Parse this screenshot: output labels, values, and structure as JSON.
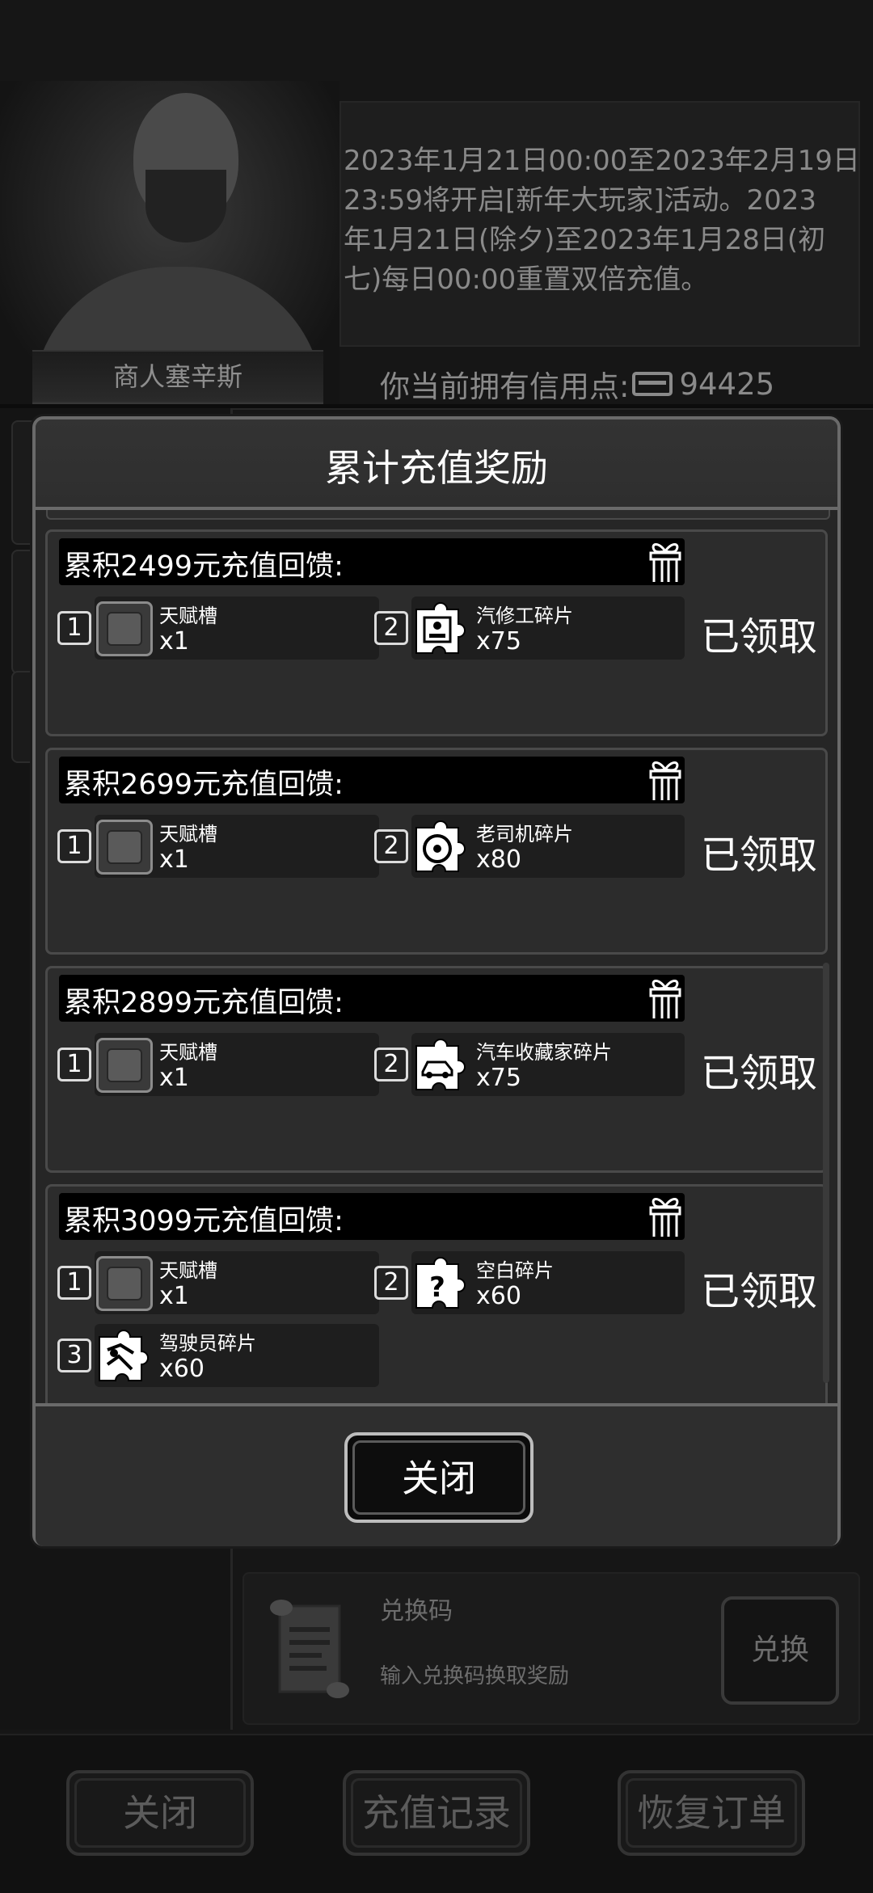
{
  "merchant": {
    "name": "商人塞辛斯",
    "notice_lines": [
      "2023年1月21日00:00至2023年2月19日",
      "23:59将开启[新年大玩家]活动。2023",
      "年1月21日(除夕)至2023年1月28日(初",
      "七)每日00:00重置双倍充值。"
    ],
    "credit_label": "你当前拥有信用点:",
    "credit_value": "94425"
  },
  "redeem": {
    "title": "兑换码",
    "hint": "输入兑换码换取奖励",
    "button_label": "兑换"
  },
  "bottom_bar": {
    "close_label": "关闭",
    "history_label": "充值记录",
    "restore_label": "恢复订单"
  },
  "dialog": {
    "title": "累计充值奖励",
    "close_label": "关闭",
    "tiers": [
      {
        "title": "累积2499元充值回馈:",
        "status": "已领取",
        "items": [
          {
            "index": "1",
            "name": "天赋槽",
            "qty": "x1",
            "icon": "talent-slot-icon"
          },
          {
            "index": "2",
            "name": "汽修工碎片",
            "qty": "x75",
            "icon": "mechanic-fragment-icon"
          }
        ]
      },
      {
        "title": "累积2699元充值回馈:",
        "status": "已领取",
        "items": [
          {
            "index": "1",
            "name": "天赋槽",
            "qty": "x1",
            "icon": "talent-slot-icon"
          },
          {
            "index": "2",
            "name": "老司机碎片",
            "qty": "x80",
            "icon": "veteran-driver-fragment-icon"
          }
        ]
      },
      {
        "title": "累积2899元充值回馈:",
        "status": "已领取",
        "items": [
          {
            "index": "1",
            "name": "天赋槽",
            "qty": "x1",
            "icon": "talent-slot-icon"
          },
          {
            "index": "2",
            "name": "汽车收藏家碎片",
            "qty": "x75",
            "icon": "car-collector-fragment-icon"
          }
        ]
      },
      {
        "title": "累积3099元充值回馈:",
        "status": "已领取",
        "items": [
          {
            "index": "1",
            "name": "天赋槽",
            "qty": "x1",
            "icon": "talent-slot-icon"
          },
          {
            "index": "2",
            "name": "空白碎片",
            "qty": "x60",
            "icon": "blank-fragment-icon"
          },
          {
            "index": "3",
            "name": "驾驶员碎片",
            "qty": "x60",
            "icon": "driver-fragment-icon"
          }
        ]
      }
    ]
  }
}
